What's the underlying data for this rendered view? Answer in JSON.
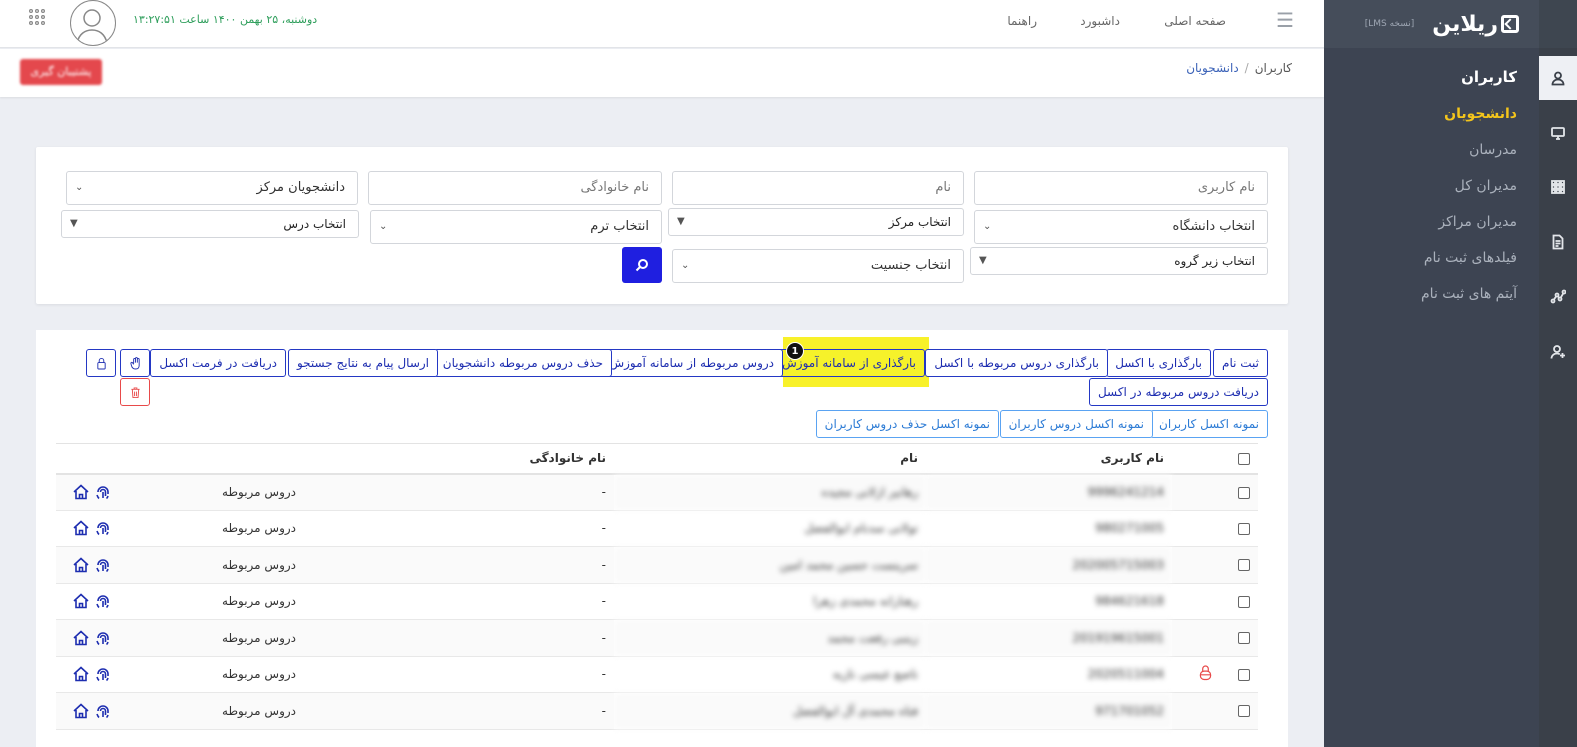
{
  "brand": {
    "logo_text": "ریلاین",
    "edition": "[نسخه LMS]"
  },
  "sidebar": {
    "section_title": "کاربران",
    "items": [
      {
        "label": "دانشجویان",
        "active": true
      },
      {
        "label": "مدرسان",
        "active": false
      },
      {
        "label": "مدیران کل",
        "active": false
      },
      {
        "label": "مدیران مراکز",
        "active": false
      },
      {
        "label": "فیلدهای ثبت نام",
        "active": false
      },
      {
        "label": "آیتم های ثبت نام",
        "active": false
      }
    ]
  },
  "iconbar": [
    "users-icon",
    "monitor-icon",
    "grid-icon",
    "document-icon",
    "chart-icon",
    "add-user-icon"
  ],
  "topbar": {
    "nav": {
      "home": "صفحه اصلی",
      "dashboard": "داشبورد",
      "help": "راهنما"
    },
    "datetime": "دوشنبه، ۲۵ بهمن ۱۴۰۰ ساعت ۱۳:۲۷:۵۱"
  },
  "breadcrumb": {
    "parent": "کاربران",
    "current": "دانشجویان"
  },
  "red_button": "پشتیبان گیری",
  "filters": {
    "username_placeholder": "نام کاربری",
    "firstname_placeholder": "نام",
    "lastname_placeholder": "نام خانوادگی",
    "center_students": "دانشجویان مرکز",
    "university": "انتخاب دانشگاه",
    "center": "انتخاب مرکز",
    "term": "انتخاب ترم",
    "course": "انتخاب درس",
    "subgroup": "انتخاب زیر گروه",
    "gender": "انتخاب جنسیت"
  },
  "actions": {
    "register": "ثبت نام",
    "upload_excel": "بارگذاری با اکسل",
    "upload_related_courses_excel": "بارگذاری دروس مربوطه با اکسل",
    "upload_from_edu": "بارگذاری از سامانه آموزش",
    "related_courses_from_edu": "دروس مربوطه از سامانه آموزش",
    "delete_related_courses": "حذف دروس مربوطه دانشجویان",
    "send_message": "ارسال پیام به نتایج جستجو",
    "download_excel": "دریافت در فرمت اکسل",
    "download_related_courses_excel": "دریافت دروس مربوطه در اکسل",
    "sample_users_excel": "نمونه اکسل کاربران",
    "sample_user_courses_excel": "نمونه اکسل دروس کاربران",
    "sample_delete_user_courses_excel": "نمونه اکسل حذف دروس کاربران",
    "badge": "1"
  },
  "table": {
    "headers": {
      "username": "نام کاربری",
      "name": "نام",
      "lastname": "نام خانوادگی"
    },
    "rows": [
      {
        "username": "9996241214",
        "name": "رهانیر ازلانی مجیده",
        "lastname": "-",
        "link": "دروس مربوطه",
        "locked": false
      },
      {
        "username": "980271005",
        "name": "تولانی سدنام ابوالفضل",
        "lastname": "-",
        "link": "دروس مربوطه",
        "locked": false
      },
      {
        "username": "202005715003",
        "name": "سرینست حسین محمد امین",
        "lastname": "-",
        "link": "دروس مربوطه",
        "locked": false
      },
      {
        "username": "984621618",
        "name": "رهنارانه محمدی زهرا",
        "lastname": "-",
        "link": "دروس مربوطه",
        "locked": false
      },
      {
        "username": "201919615001",
        "name": "زینبی رفعت محمد",
        "lastname": "-",
        "link": "دروس مربوطه",
        "locked": false
      },
      {
        "username": "2020511004",
        "name": "ناصع عیسی نازیه",
        "lastname": "-",
        "link": "دروس مربوطه",
        "locked": true
      },
      {
        "username": "971701052",
        "name": "فتاه محمدی آل ابوالفضل",
        "lastname": "-",
        "link": "دروس مربوطه",
        "locked": false
      }
    ]
  },
  "colors": {
    "accent": "#1f1fe0",
    "sidebar": "#3d4452",
    "active_menu": "#f4c51b",
    "highlight": "#f8f12a",
    "datetime": "#2e9e5b"
  }
}
